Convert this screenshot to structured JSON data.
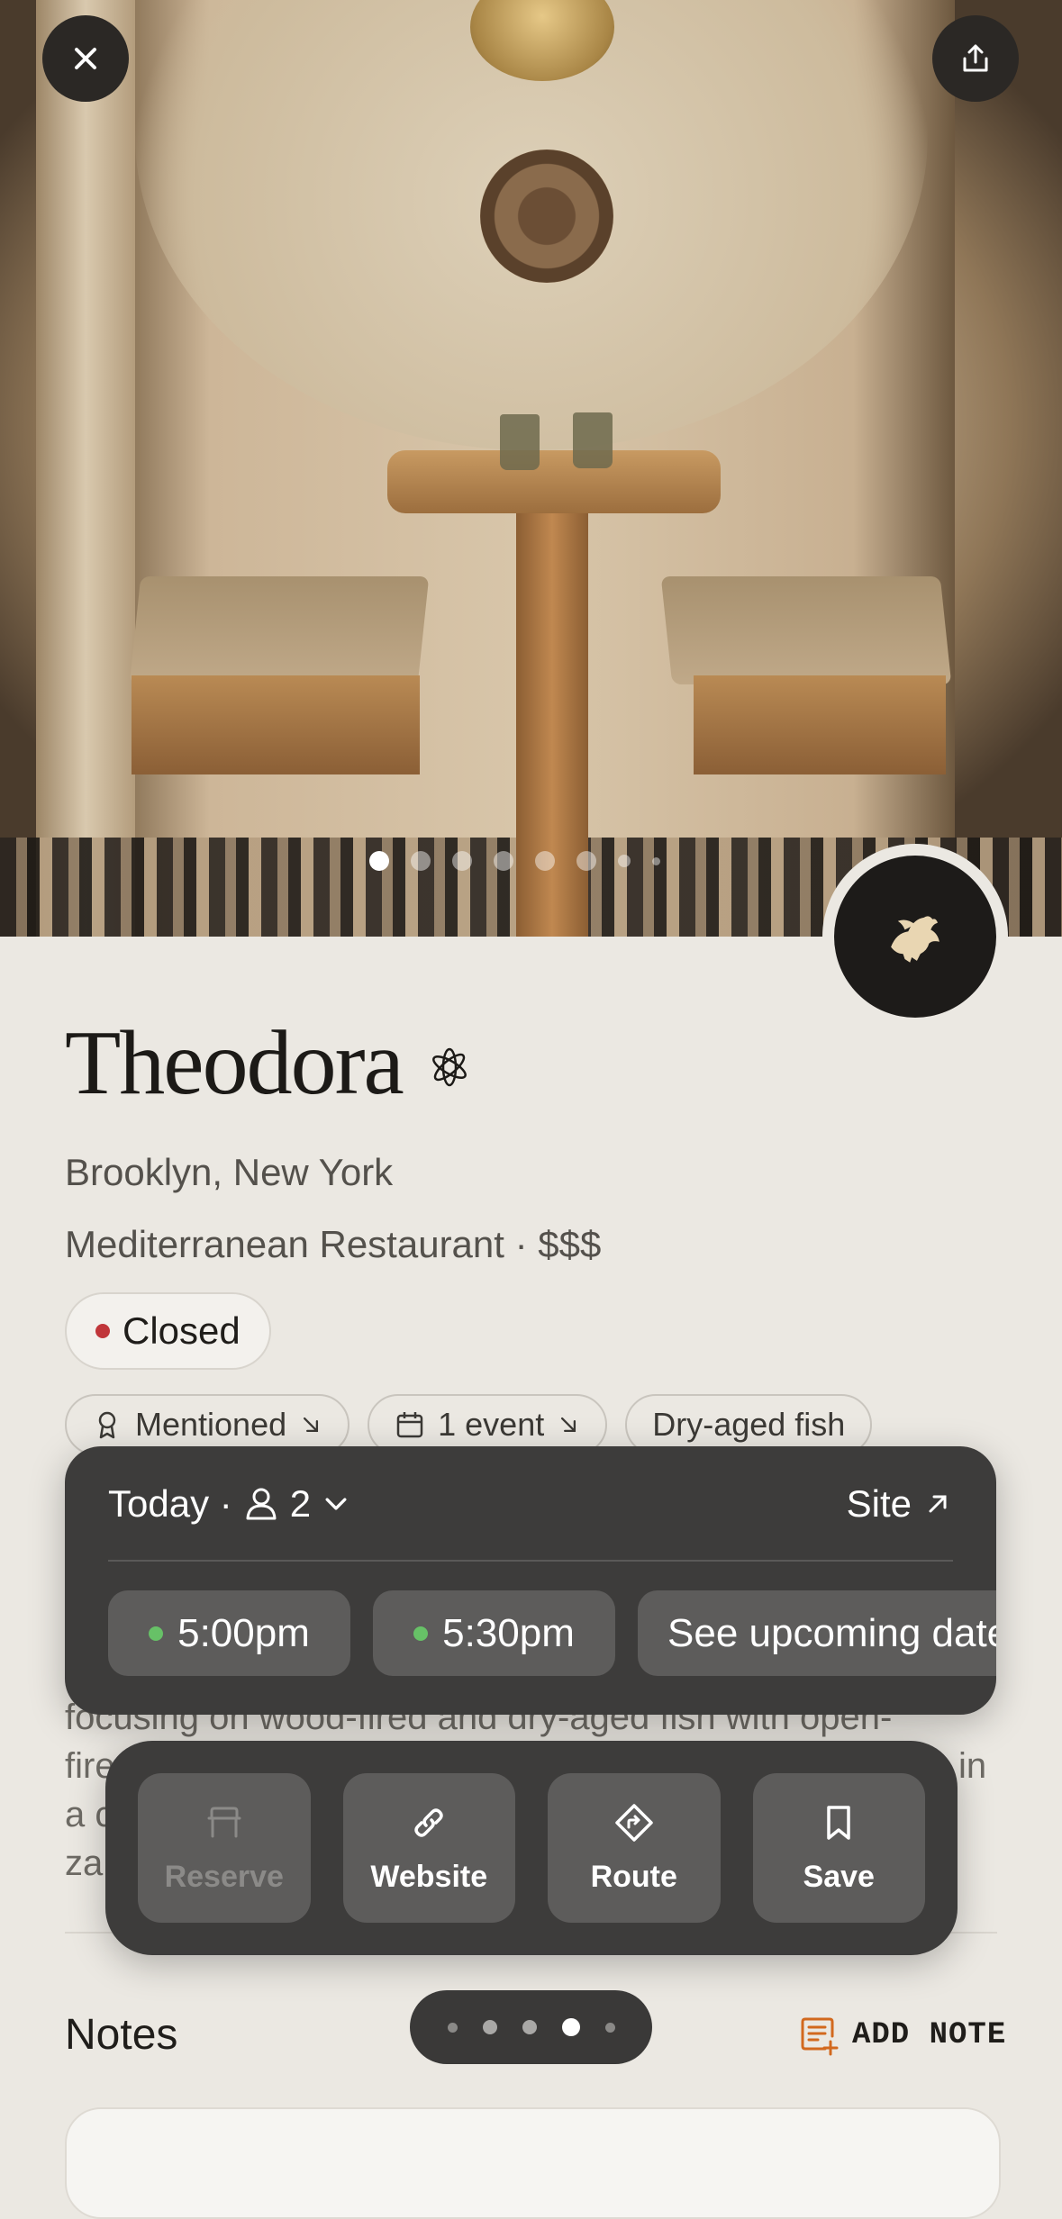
{
  "place": {
    "name": "Theodora",
    "location": "Brooklyn, New York",
    "category": "Mediterranean Restaurant · $$$",
    "status": "Closed",
    "chips": [
      "Mentioned",
      "1 event",
      "Dry-aged fish"
    ]
  },
  "description": [
    "focusing on wood-fired and dry-aged fish with open-",
    "fire",
    "a c",
    "za"
  ],
  "description_tail": "in",
  "reservation": {
    "date_label": "Today ·",
    "party_size": "2",
    "site_label": "Site",
    "slots": [
      "5:00pm",
      "5:30pm"
    ],
    "upcoming_label": "See upcoming dates"
  },
  "actions": {
    "reserve": "Reserve",
    "website": "Website",
    "route": "Route",
    "save": "Save"
  },
  "notes": {
    "title": "Notes",
    "add_note": "ADD NOTE"
  },
  "carousel": {
    "photo_count": 8,
    "active_index": 0
  },
  "pager": {
    "page_count": 5,
    "active_index": 3
  },
  "colors": {
    "background": "#ebe8e2",
    "panel": "#3d3c3b",
    "closed_dot": "#c0363a",
    "available_dot": "#67c167",
    "note_icon": "#d2691e"
  }
}
